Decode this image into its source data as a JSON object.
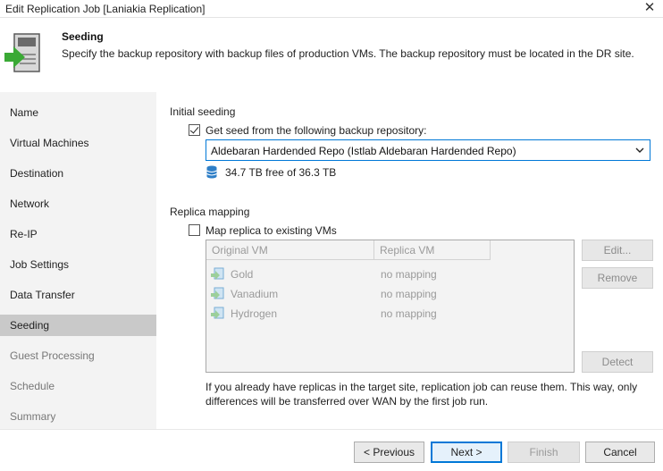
{
  "window": {
    "title": "Edit Replication Job [Laniakia Replication]",
    "close_icon": "close-icon"
  },
  "header": {
    "title": "Seeding",
    "description": "Specify the backup repository with backup files of production VMs. The backup repository must be located in the DR site.",
    "icon": "replication-seeding-icon"
  },
  "sidebar": {
    "items": [
      {
        "label": "Name",
        "state": "normal"
      },
      {
        "label": "Virtual Machines",
        "state": "normal"
      },
      {
        "label": "Destination",
        "state": "normal"
      },
      {
        "label": "Network",
        "state": "normal"
      },
      {
        "label": "Re-IP",
        "state": "normal"
      },
      {
        "label": "Job Settings",
        "state": "normal"
      },
      {
        "label": "Data Transfer",
        "state": "normal"
      },
      {
        "label": "Seeding",
        "state": "active"
      },
      {
        "label": "Guest Processing",
        "state": "disabled"
      },
      {
        "label": "Schedule",
        "state": "disabled"
      },
      {
        "label": "Summary",
        "state": "disabled"
      }
    ]
  },
  "initial_seeding": {
    "group_label": "Initial seeding",
    "checkbox_label": "Get seed from the following backup repository:",
    "checked": true,
    "repository_selected": "Aldebaran Hardended Repo (Istlab Aldebaran Hardended Repo)",
    "free_space": "34.7 TB free of 36.3 TB"
  },
  "replica_mapping": {
    "group_label": "Replica mapping",
    "checkbox_label": "Map replica to existing VMs",
    "checked": false,
    "columns": [
      "Original VM",
      "Replica VM"
    ],
    "rows": [
      {
        "original": "Gold",
        "replica": "no mapping"
      },
      {
        "original": "Vanadium",
        "replica": "no mapping"
      },
      {
        "original": "Hydrogen",
        "replica": "no mapping"
      }
    ],
    "buttons": {
      "edit": "Edit...",
      "remove": "Remove",
      "detect": "Detect"
    },
    "info": "If you already have replicas in the target site, replication job can reuse them. This way, only differences will be transferred over WAN by the first job run."
  },
  "footer": {
    "previous": "< Previous",
    "next": "Next >",
    "finish": "Finish",
    "cancel": "Cancel"
  },
  "colors": {
    "accent": "#0078d7",
    "icon_green": "#3aa935",
    "sidebar_bg": "#f3f3f3",
    "sidebar_active": "#c9c9c9"
  }
}
